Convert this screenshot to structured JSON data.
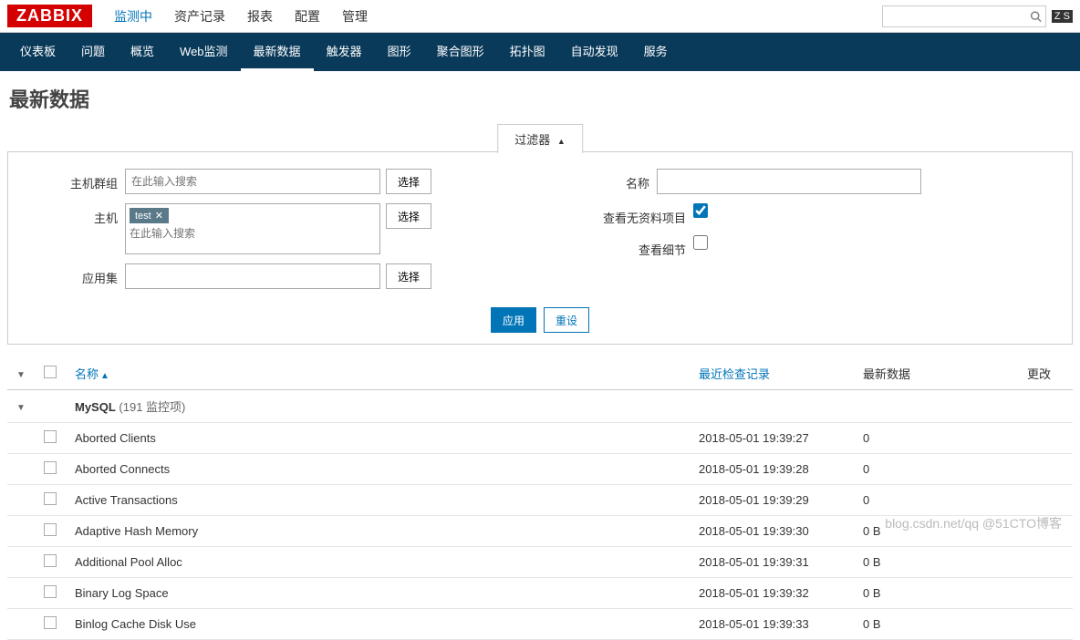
{
  "logo": "ZABBIX",
  "topnav": [
    {
      "label": "监测中",
      "active": true
    },
    {
      "label": "资产记录"
    },
    {
      "label": "报表"
    },
    {
      "label": "配置"
    },
    {
      "label": "管理"
    }
  ],
  "topright": {
    "zs": "Z S"
  },
  "subnav": [
    {
      "label": "仪表板"
    },
    {
      "label": "问题"
    },
    {
      "label": "概览"
    },
    {
      "label": "Web监测"
    },
    {
      "label": "最新数据",
      "active": true
    },
    {
      "label": "触发器"
    },
    {
      "label": "图形"
    },
    {
      "label": "聚合图形"
    },
    {
      "label": "拓扑图"
    },
    {
      "label": "自动发现"
    },
    {
      "label": "服务"
    }
  ],
  "page_title": "最新数据",
  "filter": {
    "tab_label": "过滤器",
    "host_group": {
      "label": "主机群组",
      "placeholder": "在此输入搜索",
      "select": "选择"
    },
    "host": {
      "label": "主机",
      "tag": "test",
      "placeholder": "在此输入搜索",
      "select": "选择"
    },
    "app": {
      "label": "应用集",
      "select": "选择"
    },
    "name": {
      "label": "名称"
    },
    "show_nodata": {
      "label": "查看无资料项目",
      "checked": true
    },
    "show_detail": {
      "label": "查看细节",
      "checked": false
    },
    "apply": "应用",
    "reset": "重设"
  },
  "table": {
    "headers": {
      "name": "名称",
      "last_check": "最近检查记录",
      "latest": "最新数据",
      "change": "更改"
    },
    "group": {
      "name": "MySQL",
      "count": "(191 监控项)"
    },
    "rows": [
      {
        "name": "Aborted Clients",
        "ts": "2018-05-01 19:39:27",
        "val": "0"
      },
      {
        "name": "Aborted Connects",
        "ts": "2018-05-01 19:39:28",
        "val": "0"
      },
      {
        "name": "Active Transactions",
        "ts": "2018-05-01 19:39:29",
        "val": "0"
      },
      {
        "name": "Adaptive Hash Memory",
        "ts": "2018-05-01 19:39:30",
        "val": "0 B"
      },
      {
        "name": "Additional Pool Alloc",
        "ts": "2018-05-01 19:39:31",
        "val": "0 B"
      },
      {
        "name": "Binary Log Space",
        "ts": "2018-05-01 19:39:32",
        "val": "0 B"
      },
      {
        "name": "Binlog Cache Disk Use",
        "ts": "2018-05-01 19:39:33",
        "val": "0 B"
      }
    ]
  },
  "watermark": "blog.csdn.net/qq @51CTO博客"
}
